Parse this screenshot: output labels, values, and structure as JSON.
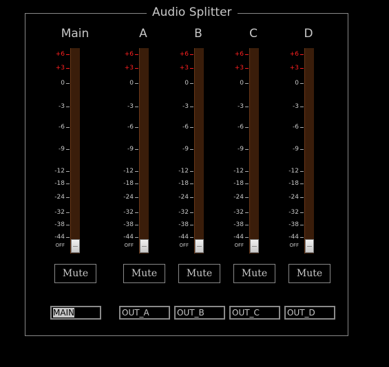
{
  "window": {
    "title": "Audio Splitter"
  },
  "scale_labels": [
    "+6",
    "+3",
    "0",
    "-3",
    "-6",
    "-9",
    "-12",
    "-18",
    "-24",
    "-32",
    "-38",
    "-44",
    "OFF"
  ],
  "scale_colors": {
    "hot": "#ff2020",
    "normal": "#c8c8c8"
  },
  "channels": [
    {
      "label": "Main",
      "mute_label": "Mute",
      "name_value": "MAIN",
      "level": "OFF"
    },
    {
      "label": "A",
      "mute_label": "Mute",
      "name_value": "OUT_A",
      "level": "OFF"
    },
    {
      "label": "B",
      "mute_label": "Mute",
      "name_value": "OUT_B",
      "level": "OFF"
    },
    {
      "label": "C",
      "mute_label": "Mute",
      "name_value": "OUT_C",
      "level": "OFF"
    },
    {
      "label": "D",
      "mute_label": "Mute",
      "name_value": "OUT_D",
      "level": "OFF"
    }
  ]
}
